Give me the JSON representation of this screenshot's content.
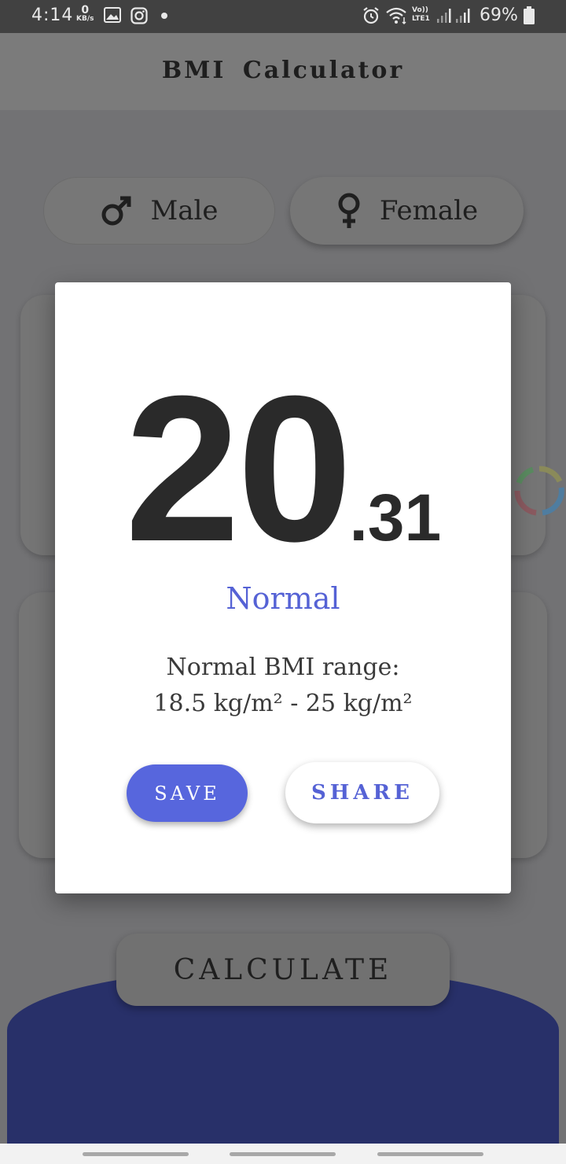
{
  "status_bar": {
    "time": "4:14",
    "net_speed_value": "0",
    "net_speed_unit": "KB/s",
    "volte": "Vo)) LTE1",
    "battery_pct": "69%",
    "icons": [
      "gallery-icon",
      "instagram-icon",
      "dot-icon",
      "alarm-icon",
      "wifi-icon",
      "signal-icon",
      "battery-icon"
    ]
  },
  "app_bar": {
    "title": "BMI  Calculator"
  },
  "gender": {
    "male_label": "Male",
    "female_label": "Female",
    "male_icon": "male-symbol-icon",
    "female_icon": "female-symbol-icon"
  },
  "calculate_label": "CALCULATE",
  "dialog": {
    "bmi_integer": "20",
    "bmi_decimal": ".31",
    "status": "Normal",
    "range_label": "Normal BMI range:",
    "range_value": "18.5 kg/m² - 25 kg/m²",
    "save_label": "SAVE",
    "share_label": "SHARE"
  },
  "colors": {
    "accent": "#5766dd",
    "status_text": "#5562d5",
    "bottom_wave": "#283069",
    "dialog_bg": "#ffffff"
  }
}
